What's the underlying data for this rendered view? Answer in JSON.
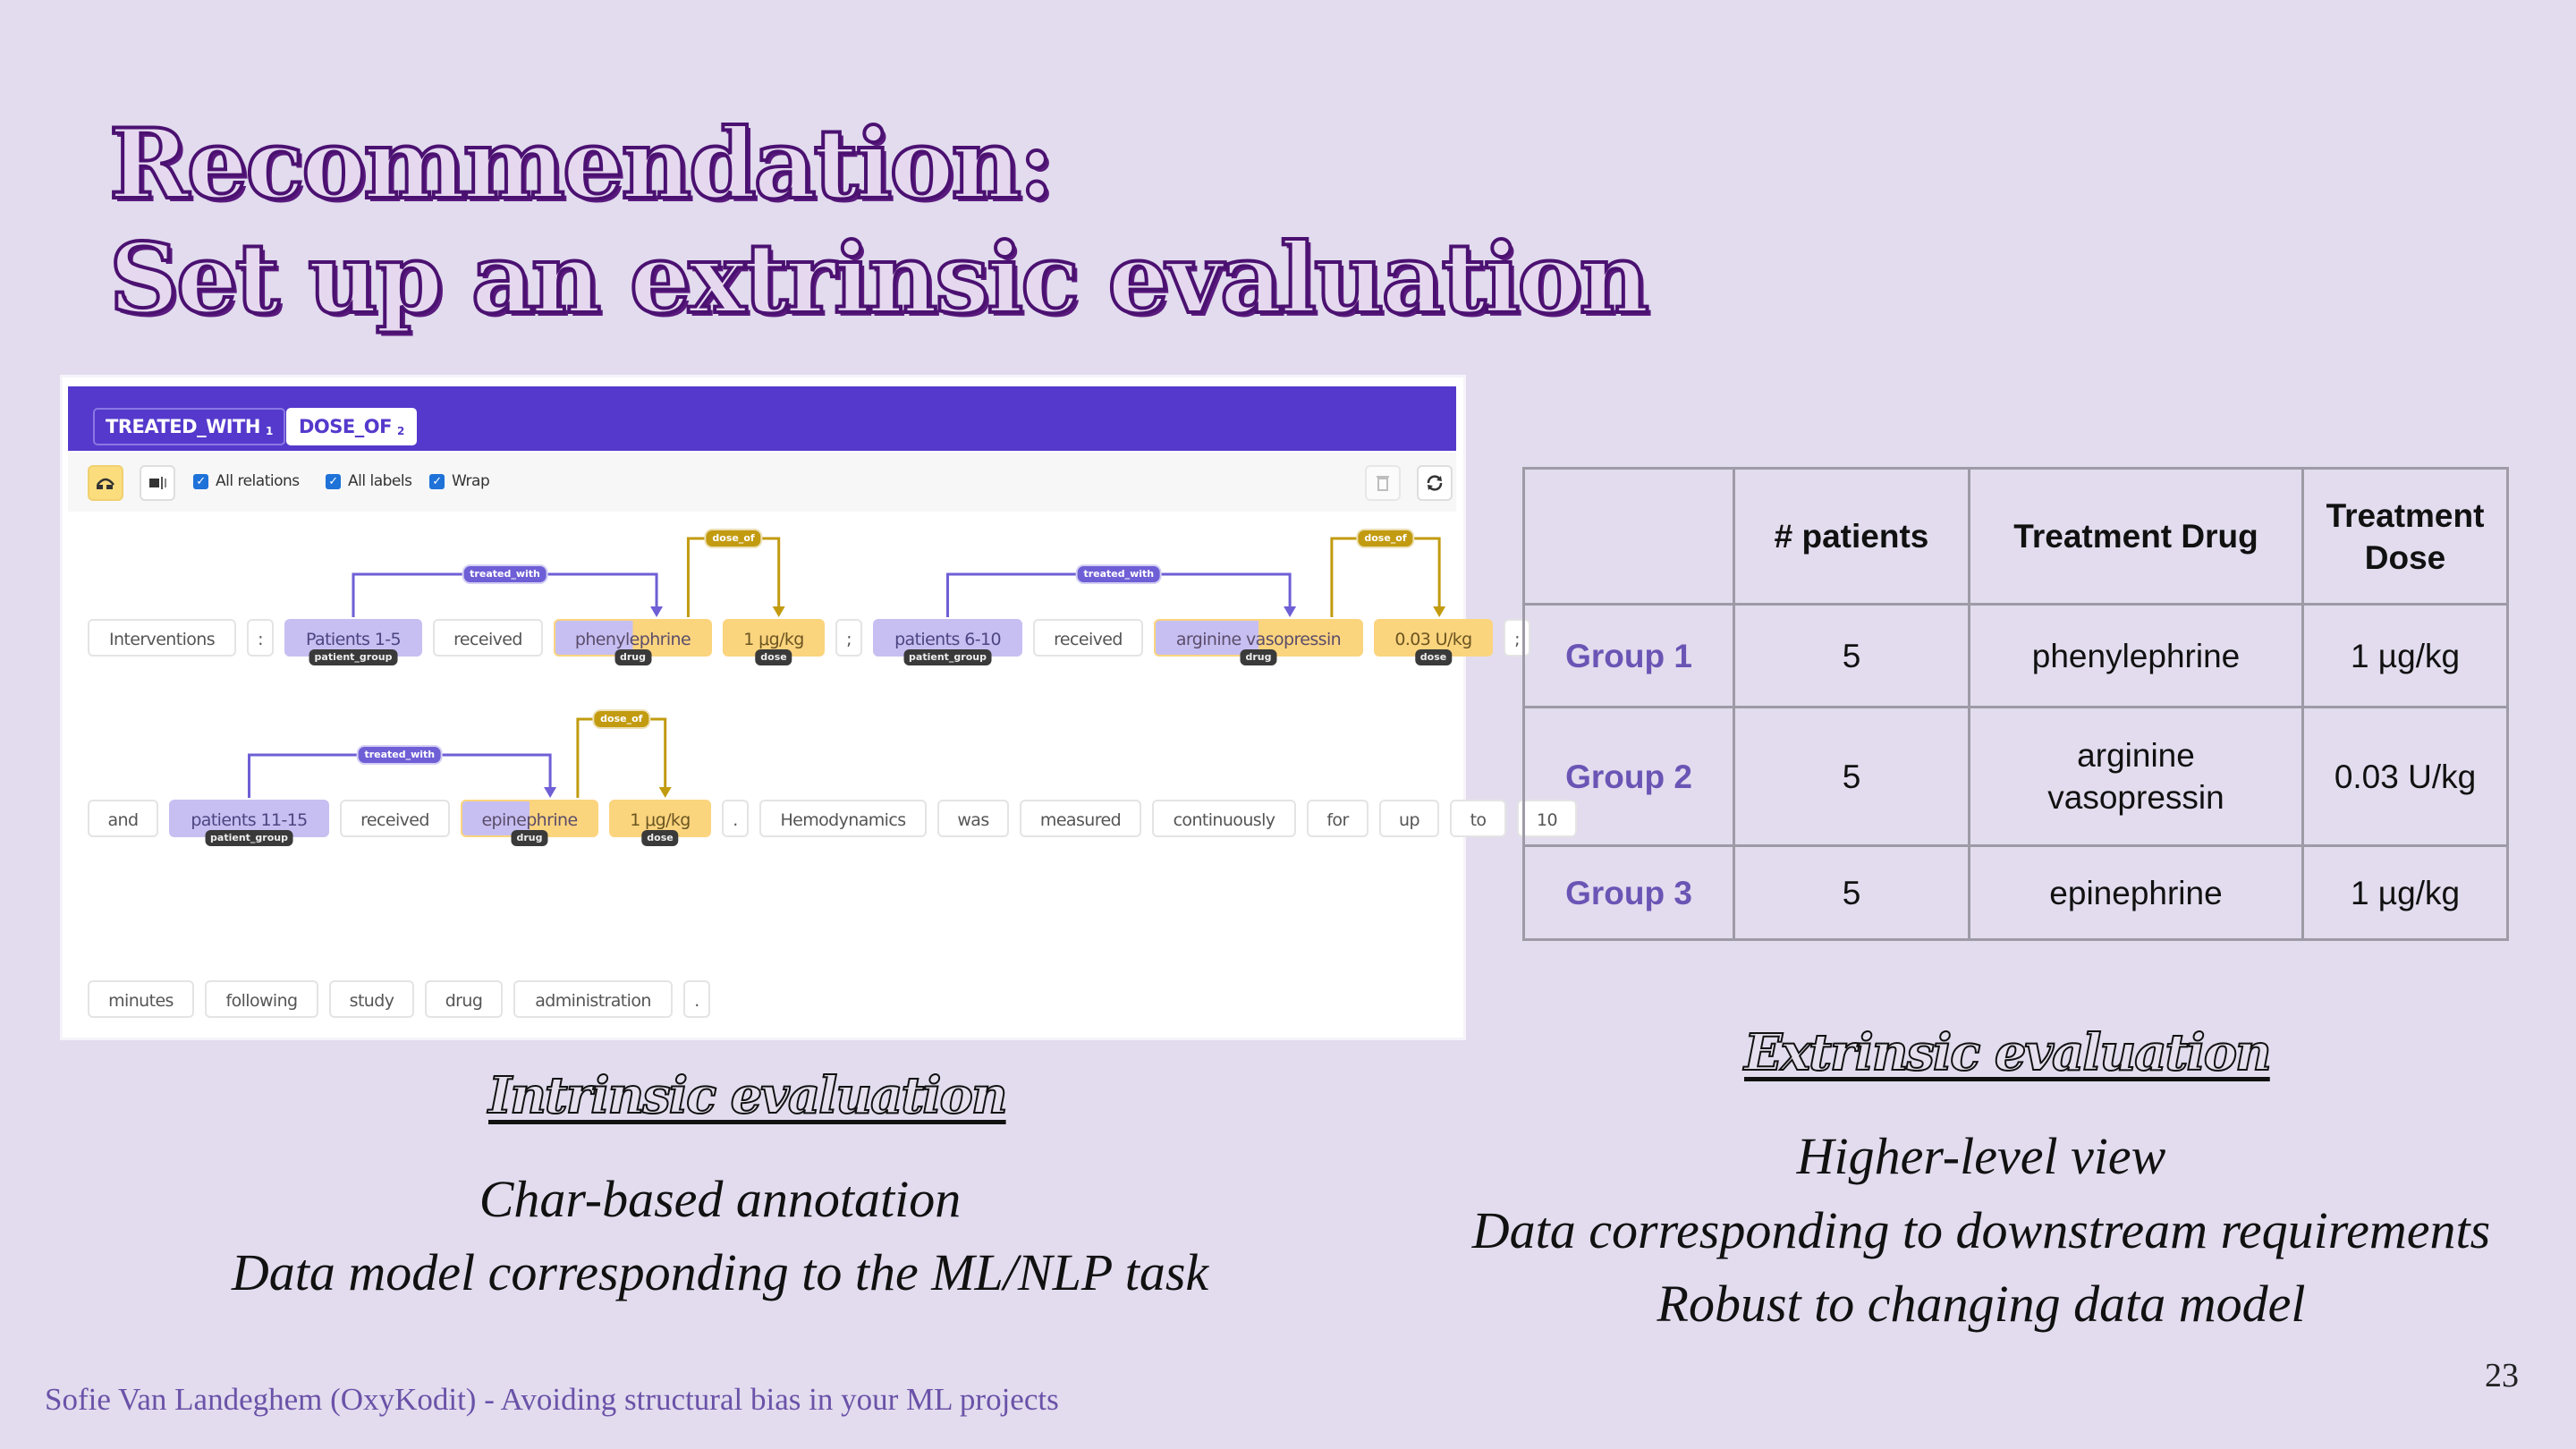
{
  "slide": {
    "title_line1": "Recommendation:",
    "title_line2": "Set up an extrinsic evaluation",
    "footer": "Sofie Van Landeghem (OxyKodit) - Avoiding structural bias in your ML projects",
    "page_number": "23"
  },
  "annotator": {
    "relation_tabs": [
      {
        "label": "TREATED_WITH",
        "shortcut": "1"
      },
      {
        "label": "DOSE_OF",
        "shortcut": "2"
      }
    ],
    "toolbar": {
      "buttons": [
        {
          "icon": "relation-mode-icon",
          "active": true
        },
        {
          "icon": "span-mode-icon",
          "active": false
        }
      ],
      "checkboxes": [
        {
          "label": "All relations",
          "checked": true
        },
        {
          "label": "All labels",
          "checked": true
        },
        {
          "label": "Wrap",
          "checked": true
        }
      ],
      "right_buttons": [
        {
          "icon": "trash-icon"
        },
        {
          "icon": "refresh-icon"
        }
      ]
    },
    "lines": [
      {
        "tokens": [
          {
            "text": "Interventions",
            "type": "plain"
          },
          {
            "text": ":",
            "type": "plain"
          },
          {
            "text": "Patients 1-5",
            "type": "patient_group",
            "label": "patient_group"
          },
          {
            "text": "received",
            "type": "plain"
          },
          {
            "text": "phenylephrine",
            "type": "drug",
            "label": "drug"
          },
          {
            "text": "1 μg/kg",
            "type": "dose",
            "label": "dose"
          },
          {
            "text": ";",
            "type": "plain"
          },
          {
            "text": "patients 6-10",
            "type": "patient_group",
            "label": "patient_group"
          },
          {
            "text": "received",
            "type": "plain"
          },
          {
            "text": "arginine vasopressin",
            "type": "drug",
            "label": "drug"
          },
          {
            "text": "0.03 U/kg",
            "type": "dose",
            "label": "dose"
          },
          {
            "text": ";",
            "type": "plain"
          }
        ],
        "relations": [
          {
            "label": "treated_with",
            "from": 2,
            "to": 4
          },
          {
            "label": "dose_of",
            "from": 4,
            "to": 5
          },
          {
            "label": "treated_with",
            "from": 7,
            "to": 9
          },
          {
            "label": "dose_of",
            "from": 9,
            "to": 10
          }
        ]
      },
      {
        "tokens": [
          {
            "text": "and",
            "type": "plain"
          },
          {
            "text": "patients 11-15",
            "type": "patient_group",
            "label": "patient_group"
          },
          {
            "text": "received",
            "type": "plain"
          },
          {
            "text": "epinephrine",
            "type": "drug",
            "label": "drug"
          },
          {
            "text": "1 μg/kg",
            "type": "dose",
            "label": "dose"
          },
          {
            "text": ".",
            "type": "plain"
          },
          {
            "text": "Hemodynamics",
            "type": "plain"
          },
          {
            "text": "was",
            "type": "plain"
          },
          {
            "text": "measured",
            "type": "plain"
          },
          {
            "text": "continuously",
            "type": "plain"
          },
          {
            "text": "for",
            "type": "plain"
          },
          {
            "text": "up",
            "type": "plain"
          },
          {
            "text": "to",
            "type": "plain"
          },
          {
            "text": "10",
            "type": "plain"
          }
        ],
        "relations": [
          {
            "label": "treated_with",
            "from": 1,
            "to": 3
          },
          {
            "label": "dose_of",
            "from": 3,
            "to": 4
          }
        ]
      },
      {
        "tokens": [
          {
            "text": "minutes",
            "type": "plain"
          },
          {
            "text": "following",
            "type": "plain"
          },
          {
            "text": "study",
            "type": "plain"
          },
          {
            "text": "drug",
            "type": "plain"
          },
          {
            "text": "administration",
            "type": "plain"
          },
          {
            "text": ".",
            "type": "plain"
          }
        ],
        "relations": []
      }
    ],
    "colors": {
      "header": "#5539cc",
      "patient_group": "#c7bff2",
      "dose": "#fbd47e",
      "treated_with_arc": "#6e5fd6",
      "dose_of_arc": "#c29b10"
    }
  },
  "table": {
    "headers": [
      "",
      "# patients",
      "Treatment Drug",
      "Treatment Dose"
    ],
    "rows": [
      {
        "group": "Group 1",
        "patients": "5",
        "drug": "phenylephrine",
        "dose": "1 µg/kg"
      },
      {
        "group": "Group 2",
        "patients": "5",
        "drug": "arginine vasopressin",
        "dose": "0.03 U/kg"
      },
      {
        "group": "Group 3",
        "patients": "5",
        "drug": "epinephrine",
        "dose": "1 µg/kg"
      }
    ]
  },
  "intrinsic": {
    "heading": "Intrinsic evaluation",
    "points": [
      "Char-based annotation",
      "Data model corresponding to the ML/NLP task"
    ]
  },
  "extrinsic": {
    "heading": "Extrinsic evaluation",
    "points": [
      "Higher-level view",
      "Data corresponding to downstream requirements",
      "Robust to changing data model"
    ]
  }
}
